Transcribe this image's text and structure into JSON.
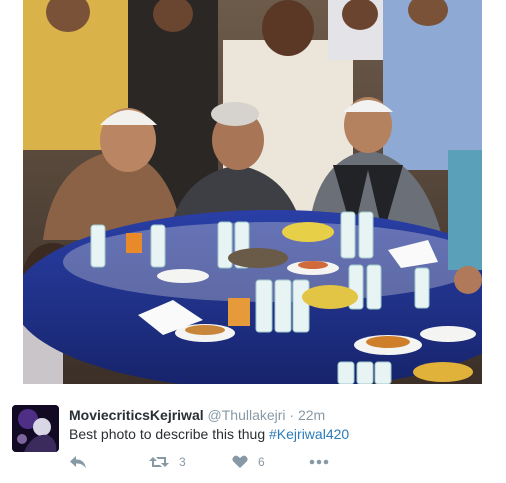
{
  "tweet": {
    "display_name": "MoviecriticsKejriwal",
    "handle": "@Thullakejri",
    "separator": "·",
    "time": "22m",
    "text_prefix": "Best photo to describe this thug ",
    "hashtag": "#Kejriwal420"
  },
  "actions": {
    "reply_icon": "reply-icon",
    "retweet_icon": "retweet-icon",
    "retweet_count": "3",
    "like_icon": "heart-icon",
    "like_count": "6",
    "more_icon": "more-dots-icon"
  },
  "colors": {
    "name": "#292f33",
    "muted": "#8899a6",
    "hashtag": "#2b7bb9",
    "tablecloth": "#1d2f8a"
  }
}
